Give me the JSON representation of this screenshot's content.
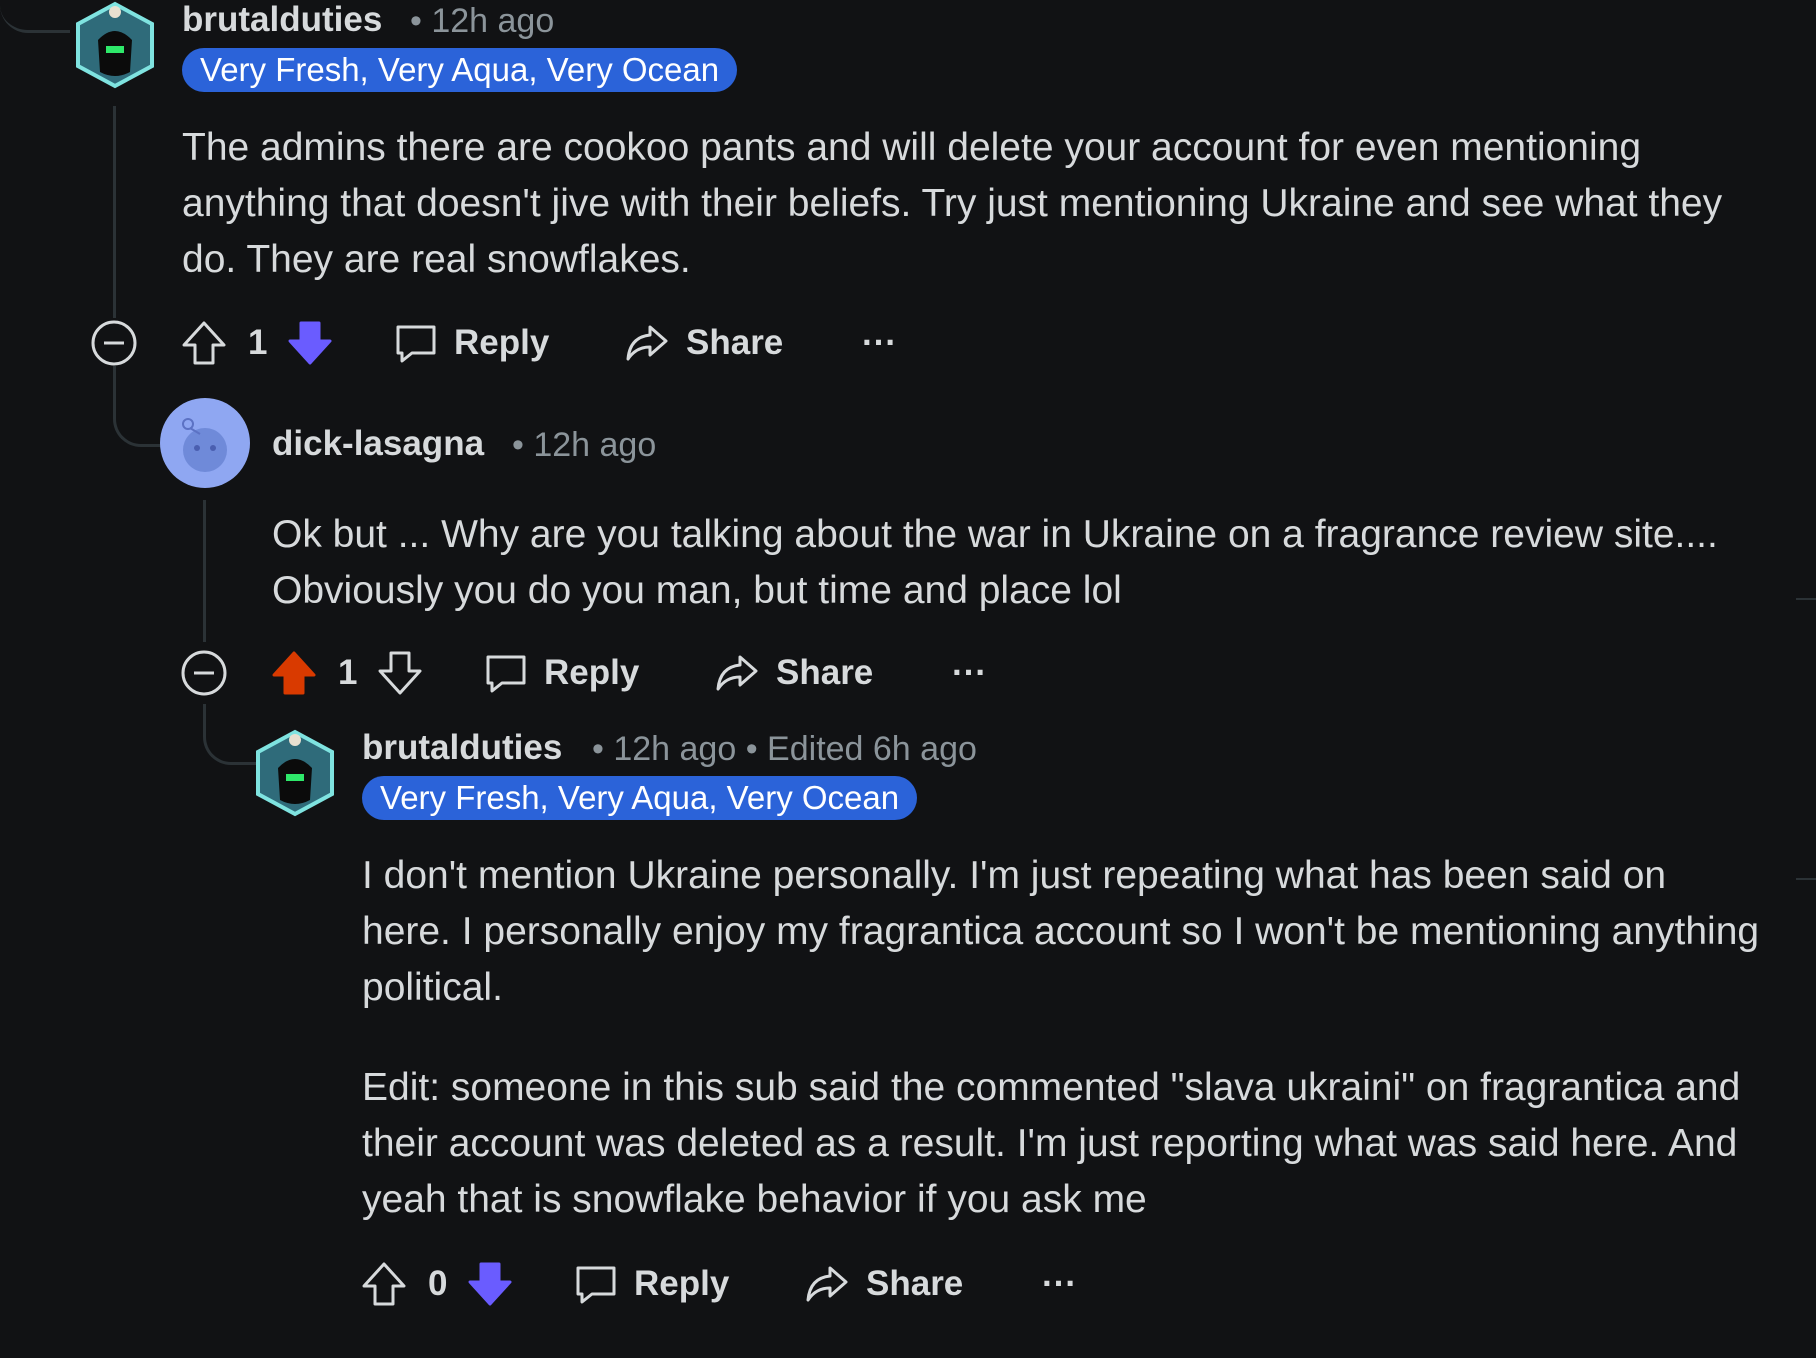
{
  "comments": [
    {
      "username": "brutalduties",
      "meta": "• 12h ago",
      "flair": "Very Fresh, Very Aqua, Very Ocean",
      "body": [
        "The admins there are cookoo pants and will delete your account for even mentioning anything that doesn't jive with their beliefs. Try just mentioning Ukraine and see what they do. They are real snowflakes."
      ],
      "score": "1",
      "vote_state": "downvoted",
      "reply_label": "Reply",
      "share_label": "Share",
      "more_label": "···"
    },
    {
      "username": "dick-lasagna",
      "meta": "• 12h ago",
      "body": [
        "Ok but ... Why are you talking about the war in Ukraine on a fragrance review site.... Obviously you do you man, but time and place lol"
      ],
      "score": "1",
      "vote_state": "upvoted",
      "reply_label": "Reply",
      "share_label": "Share",
      "more_label": "···"
    },
    {
      "username": "brutalduties",
      "meta": "• 12h ago • Edited 6h ago",
      "flair": "Very Fresh, Very Aqua, Very Ocean",
      "body": [
        "I don't mention Ukraine personally. I'm just repeating what has been said on here. I personally enjoy my fragrantica account so I won't be mentioning anything political.",
        "Edit: someone in this sub said the commented \"slava ukraini\" on fragrantica and their account was deleted as a result. I'm just reporting what was said here. And yeah that is snowflake behavior if you ask me"
      ],
      "score": "0",
      "vote_state": "downvoted",
      "reply_label": "Reply",
      "share_label": "Share",
      "more_label": "···"
    }
  ],
  "colors": {
    "background": "#111214",
    "text": "#d7dadc",
    "muted": "#8b949a",
    "flair_bg": "#2b63d9",
    "upvote": "#d93a00",
    "downvote": "#6a5cff",
    "thread_line": "#2b3236"
  },
  "icons": [
    "upvote-icon",
    "downvote-icon",
    "reply-icon",
    "share-icon",
    "collapse-icon",
    "more-icon"
  ]
}
